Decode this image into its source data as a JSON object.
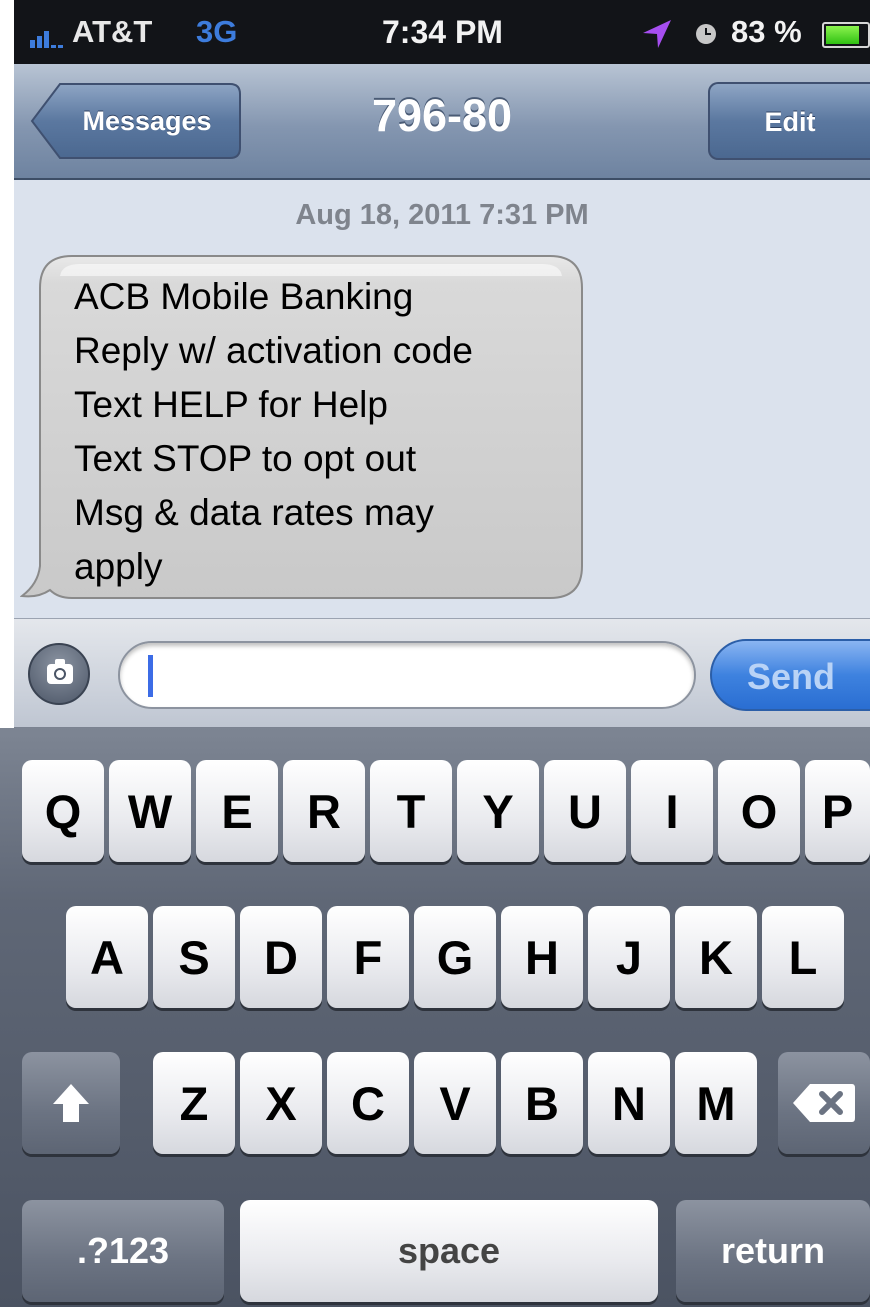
{
  "status_bar": {
    "carrier": "AT&T",
    "network": "3G",
    "time": "7:34 PM",
    "battery": "83 %",
    "battery_level": 0.83,
    "icons": [
      "signal-bars-icon",
      "location-arrow-icon",
      "alarm-clock-icon",
      "battery-icon"
    ]
  },
  "nav": {
    "back_label": "Messages",
    "title": "796-80",
    "edit_label": "Edit"
  },
  "thread": {
    "timestamp": "Aug 18, 2011 7:31 PM",
    "message": "ACB Mobile Banking\nReply w/ activation code\nText HELP for Help\nText STOP to opt out\nMsg & data rates may\napply"
  },
  "compose": {
    "value": "",
    "placeholder": "",
    "send_label": "Send",
    "camera_icon": "camera-icon"
  },
  "keyboard": {
    "row1": [
      "Q",
      "W",
      "E",
      "R",
      "T",
      "Y",
      "U",
      "I",
      "O",
      "P"
    ],
    "row2": [
      "A",
      "S",
      "D",
      "F",
      "G",
      "H",
      "J",
      "K",
      "L"
    ],
    "row3": [
      "Z",
      "X",
      "C",
      "V",
      "B",
      "N",
      "M"
    ],
    "numbers_label": ".?123",
    "space_label": "space",
    "return_label": "return",
    "shift_icon": "shift-arrow-icon",
    "backspace_icon": "backspace-icon"
  }
}
